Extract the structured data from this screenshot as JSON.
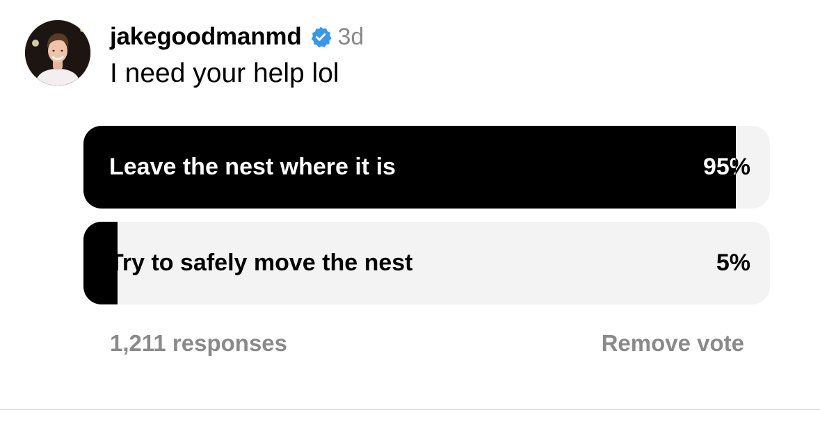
{
  "post": {
    "username": "jakegoodmanmd",
    "verified": true,
    "time_ago": "3d",
    "caption": "I need your help lol",
    "avatar_icon": "profile-photo"
  },
  "poll": {
    "options": [
      {
        "label": "Leave the nest where it is",
        "percent_text": "95%",
        "percent": 95,
        "selected": true
      },
      {
        "label": "Try to safely move the nest",
        "percent_text": "5%",
        "percent": 5,
        "selected": false
      }
    ],
    "responses_text": "1,211 responses",
    "remove_vote_label": "Remove vote"
  },
  "colors": {
    "fill": "#000000",
    "track": "#f3f3f3",
    "muted_text": "#8a8a8a",
    "verified_blue": "#3897f0"
  }
}
